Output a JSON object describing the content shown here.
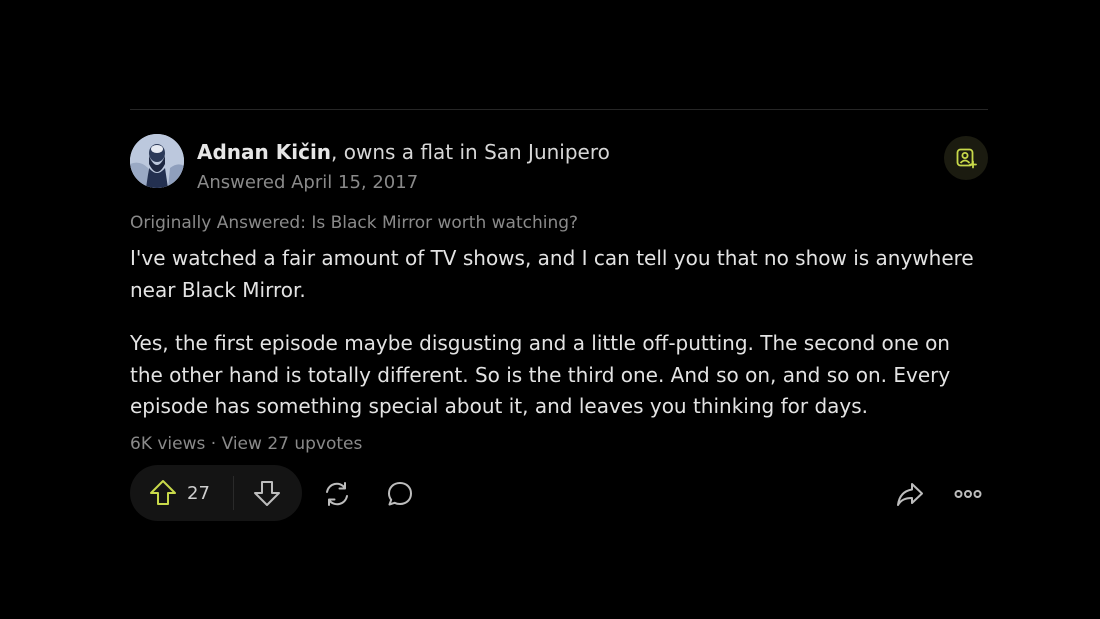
{
  "answer": {
    "author": {
      "name": "Adnan Kičin",
      "credential": ", owns a flat in San Junipero",
      "answered_date": "Answered April 15, 2017"
    },
    "originally_answered": "Originally Answered: Is Black Mirror worth watching?",
    "paragraphs": [
      "I've watched a fair amount of TV shows, and I can tell you that no show is anywhere near Black Mirror.",
      "Yes, the first episode maybe disgusting and a little off-putting. The second one on the other hand is totally different. So is the third one. And so on, and so on. Every episode has something special about it, and leaves you thinking for days."
    ],
    "stats": "6K views · View 27 upvotes",
    "upvote_count": "27"
  },
  "icons": {
    "follow": "add-user-icon",
    "upvote": "arrow-up-icon",
    "downvote": "arrow-down-icon",
    "reshare": "reshare-icon",
    "comment": "comment-icon",
    "share": "share-icon",
    "more": "more-icon"
  },
  "colors": {
    "background": "#000000",
    "accent": "#c8d94a",
    "text": "#e3e3e3",
    "muted": "#8a8a8a"
  }
}
